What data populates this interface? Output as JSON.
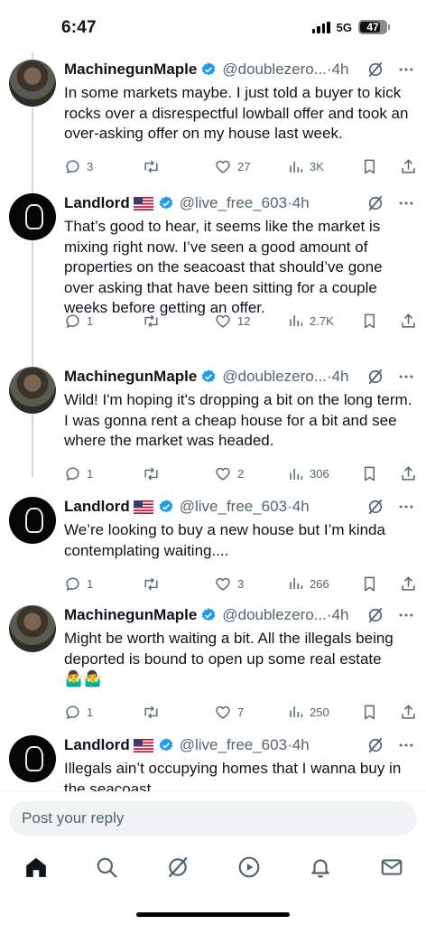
{
  "status": {
    "time": "6:47",
    "network": "5G",
    "battery": "47"
  },
  "tweets": [
    {
      "name": "MachinegunMaple",
      "handle": "@doublezero...",
      "time": "4h",
      "text": "In some markets maybe. I just told a buyer to kick rocks over a disrespectful lowball offer and took an over-asking offer on my house last week.",
      "replies": "3",
      "reposts": "",
      "likes": "27",
      "views": "3K",
      "flag": false
    },
    {
      "name": "Landlord",
      "handle": "@live_free_603",
      "time": "4h",
      "text": "That’s good to hear, it seems like the market is mixing right now. I’ve seen a good amount of properties on the seacoast that should’ve gone over asking that have been sitting for a couple weeks before getting an offer.",
      "replies": "1",
      "reposts": "",
      "likes": "12",
      "views": "2.7K",
      "flag": true
    },
    {
      "name": "MachinegunMaple",
      "handle": "@doublezero...",
      "time": "4h",
      "text": "Wild! I'm hoping it's dropping a bit on the long term. I was gonna rent a cheap house for a bit and see where the market was headed.",
      "replies": "1",
      "reposts": "",
      "likes": "2",
      "views": "306",
      "flag": false
    },
    {
      "name": "Landlord",
      "handle": "@live_free_603",
      "time": "4h",
      "text": "We’re looking to buy a new house but I’m kinda contemplating waiting....",
      "replies": "1",
      "reposts": "",
      "likes": "3",
      "views": "266",
      "flag": true
    },
    {
      "name": "MachinegunMaple",
      "handle": "@doublezero...",
      "time": "4h",
      "text": "Might be worth waiting a bit. All the illegals being deported is bound to open up some real estate",
      "emoji": "🤷‍♂️🤷‍♂️",
      "replies": "1",
      "reposts": "",
      "likes": "7",
      "views": "250",
      "flag": false
    },
    {
      "name": "Landlord",
      "handle": "@live_free_603",
      "time": "4h",
      "text": "Illegals ain’t occupying homes that I wanna buy in the seacoast",
      "flag": true
    }
  ],
  "separator": "·",
  "reply": {
    "placeholder": "Post your reply"
  },
  "nav": [
    "home-icon",
    "search-icon",
    "grok-icon",
    "video-icon",
    "notifications-icon",
    "messages-icon"
  ],
  "colors": {
    "verified": "#1d9bf0",
    "muted": "#536471",
    "text": "#0f1419"
  }
}
